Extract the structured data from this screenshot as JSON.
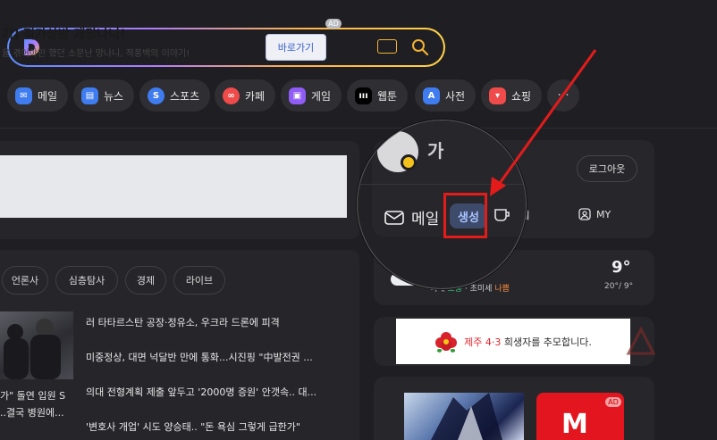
{
  "search": {
    "placeholder": ""
  },
  "chips": [
    {
      "label": "메일",
      "icon": "mail-icon",
      "color": "#3f7cf0"
    },
    {
      "label": "뉴스",
      "icon": "news-icon",
      "color": "#3f7cf0"
    },
    {
      "label": "스포츠",
      "icon": "sports-icon",
      "color": "#3f7cf0"
    },
    {
      "label": "카페",
      "icon": "cafe-icon",
      "color": "#ef4b4b"
    },
    {
      "label": "게임",
      "icon": "game-icon",
      "color": "#8f5cf6"
    },
    {
      "label": "웹툰",
      "icon": "webtoon-icon",
      "color": "#000000"
    },
    {
      "label": "사전",
      "icon": "dictionary-icon",
      "color": "#3f7cf0"
    },
    {
      "label": "쇼핑",
      "icon": "shopping-icon",
      "color": "#ef4b4b"
    },
    {
      "label": "···",
      "icon": "more-icon",
      "color": "#2e2e33"
    }
  ],
  "ad": {
    "title": "기] 적가상방 개망나니!",
    "desc": "을 겪어야만 했던 소문난 망나니, 적풍백의 이야기!",
    "button": "바로가기",
    "badge": "AD"
  },
  "news": {
    "tabs": [
      "언론사",
      "심층탐사",
      "경제",
      "라이브"
    ],
    "thumb_caption_1": "가\" 돌연 입원 S",
    "thumb_caption_2": "..결국 병원에...",
    "headlines": [
      "러 타타르스탄 공장·정유소, 우크라 드론에 피격",
      "미중정상, 대면 넉달반 만에 통화...시진핑 \"中발전권 ...",
      "의대 전형계획 제출 앞두고 '2000명 증원' 안갯속.. 대...",
      "'변호사 개업' 시도 양승태.. \"돈 욕심 그렇게 급한가\""
    ]
  },
  "profile": {
    "name": "가",
    "logout": "로그아웃",
    "mail_label": "메일",
    "mail_badge": "생성",
    "cafe": "카페",
    "my": "MY"
  },
  "weather": {
    "title": "흐림",
    "dust_label": "미세",
    "dust_value": "보통",
    "ultra_label": "초미세",
    "ultra_value": "나쁨",
    "temp": "9°",
    "range": "20°/ 9°"
  },
  "banner": {
    "red": "제주 4·3",
    "rest": "희생자를 추모합니다."
  },
  "shopping": {
    "badge": "AD"
  }
}
